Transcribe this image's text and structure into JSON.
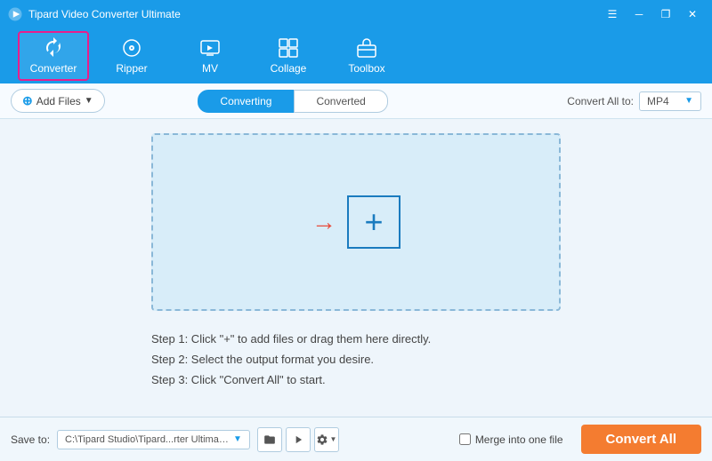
{
  "titleBar": {
    "appName": "Tipard Video Converter Ultimate",
    "controls": {
      "minimize": "─",
      "maximize": "□",
      "close": "✕",
      "settings": "☰",
      "restore": "❐"
    }
  },
  "nav": {
    "items": [
      {
        "id": "converter",
        "label": "Converter",
        "active": true
      },
      {
        "id": "ripper",
        "label": "Ripper",
        "active": false
      },
      {
        "id": "mv",
        "label": "MV",
        "active": false
      },
      {
        "id": "collage",
        "label": "Collage",
        "active": false
      },
      {
        "id": "toolbox",
        "label": "Toolbox",
        "active": false
      }
    ]
  },
  "toolbar": {
    "addFilesLabel": "Add Files",
    "tabs": [
      {
        "id": "converting",
        "label": "Converting",
        "active": true
      },
      {
        "id": "converted",
        "label": "Converted",
        "active": false
      }
    ],
    "convertAllToLabel": "Convert All to:",
    "formatValue": "MP4"
  },
  "dropZone": {
    "arrowSymbol": "→",
    "plusSymbol": "+"
  },
  "instructions": [
    "Step 1: Click \"+\" to add files or drag them here directly.",
    "Step 2: Select the output format you desire.",
    "Step 3: Click \"Convert All\" to start."
  ],
  "bottomBar": {
    "saveToLabel": "Save to:",
    "savePath": "C:\\Tipard Studio\\Tipard...rter Ultimate\\Converted",
    "mergeLabel": "Merge into one file",
    "convertAllLabel": "Convert All"
  }
}
